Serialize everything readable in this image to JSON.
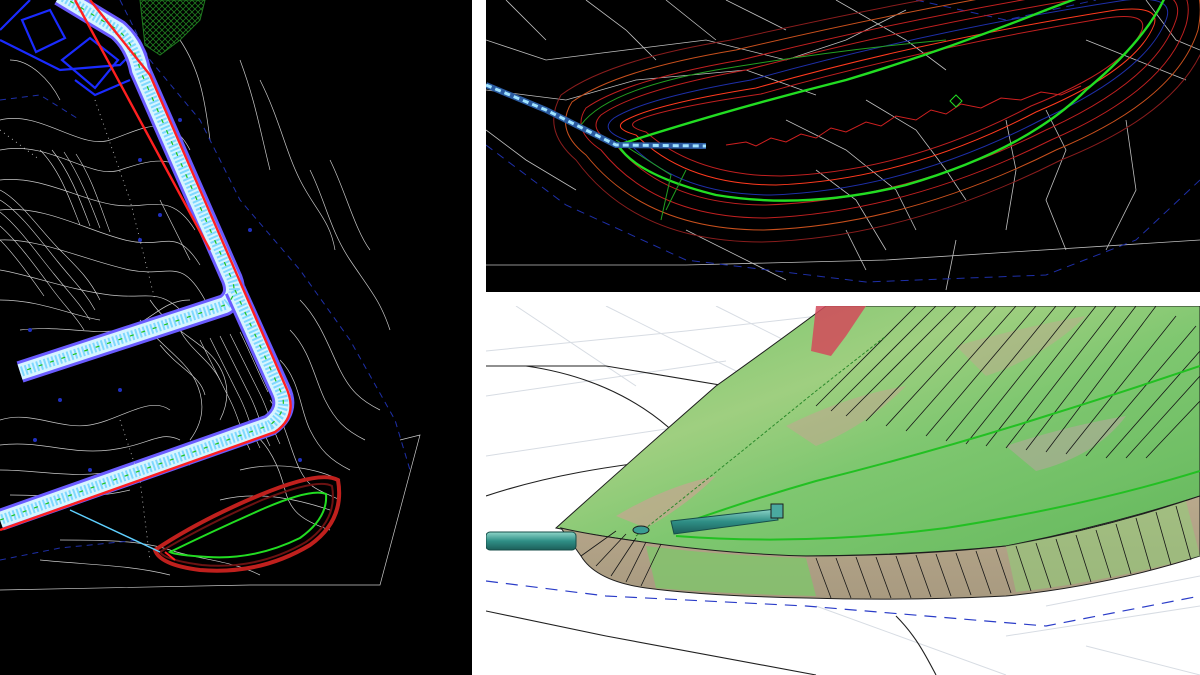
{
  "views": [
    {
      "id": "plan",
      "kind": "2d-plan",
      "background": "#000000"
    },
    {
      "id": "detail",
      "kind": "2d-plan-zoom",
      "background": "#000000"
    },
    {
      "id": "model",
      "kind": "3d-surface",
      "background": "#ffffff"
    }
  ],
  "colors": {
    "contour": "#bdbdbd",
    "boundary": "#1e2fa8",
    "road_edge": "#ff2020",
    "road_core": "#8a6bff",
    "pipe": "#5fd0ff",
    "grading": "#22dd22",
    "hatch": "#1f7a1f",
    "surface_green": "#6ec463",
    "surface_tan": "#b9a98c",
    "surface_red": "#d24a5a",
    "pipe_3d": "#2f8f86"
  }
}
